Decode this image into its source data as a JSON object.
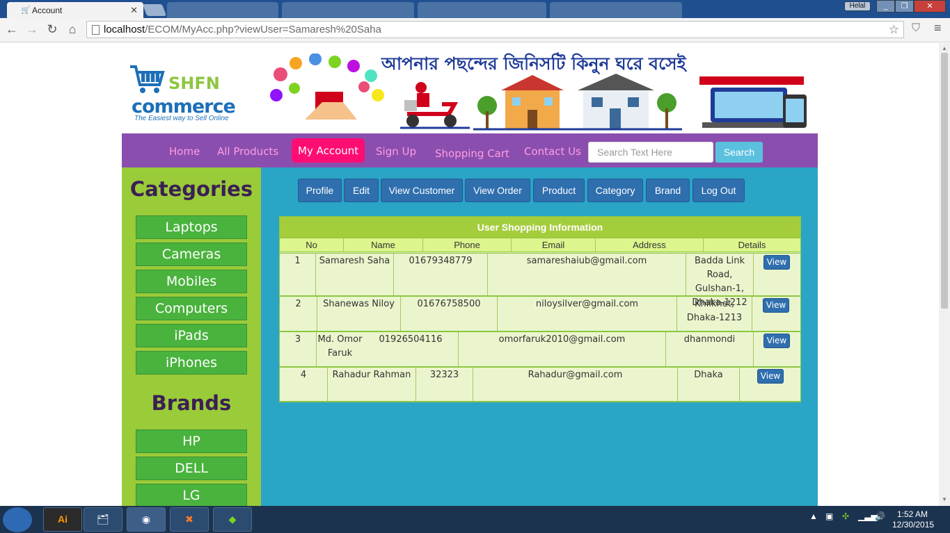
{
  "browser": {
    "active_tab_title": "Account",
    "other_tabs": [
      "",
      "",
      "",
      ""
    ],
    "url_host": "localhost",
    "url_path": "/ECOM/MyAcc.php?viewUser=Samaresh%20Saha",
    "window_user": "Helal"
  },
  "banner": {
    "logo_main": "SHFN",
    "logo_sub": "commerce",
    "logo_tagline": "The Easiest way to Sell Online",
    "tagline": "আপনার পছন্দের জিনিসটি কিনুন ঘরে বসেই"
  },
  "nav": {
    "items": [
      "Home",
      "All Products",
      "My Account",
      "Sign Up",
      "Shopping Cart",
      "Contact Us"
    ],
    "active": "My Account",
    "search_placeholder": "Search Text Here",
    "search_button": "Search"
  },
  "sidebar": {
    "categories_heading": "Categories",
    "categories": [
      "Laptops",
      "Cameras",
      "Mobiles",
      "Computers",
      "iPads",
      "iPhones"
    ],
    "brands_heading": "Brands",
    "brands": [
      "HP",
      "DELL",
      "LG"
    ]
  },
  "admin_menu": [
    "Profile",
    "Edit",
    "View Customer",
    "View Order",
    "Product",
    "Category",
    "Brand",
    "Log Out"
  ],
  "table": {
    "title": "User Shopping Information",
    "headers": [
      "No",
      "Name",
      "Phone",
      "Email",
      "Address",
      "Details"
    ],
    "rows": [
      {
        "no": "1",
        "name": "Samaresh Saha",
        "phone": "01679348779",
        "email": "samareshaiub@gmail.com",
        "address": "Badda Link Road, Gulshan-1, Dhaka-1212",
        "action": "View"
      },
      {
        "no": "2",
        "name": "Shanewas Niloy",
        "phone": "01676758500",
        "email": "niloysilver@gmail.com",
        "address": "Khilkhet, Dhaka-1213",
        "action": "View"
      },
      {
        "no": "3",
        "name": "Md. Omor Faruk",
        "phone": "01926504116",
        "email": "omorfaruk2010@gmail.com",
        "address": "dhanmondi",
        "action": "View"
      },
      {
        "no": "4",
        "name": "Rahadur Rahman",
        "phone": "32323",
        "email": "Rahadur@gmail.com",
        "address": "Dhaka",
        "action": "View"
      }
    ]
  },
  "taskbar": {
    "time": "1:52 AM",
    "date": "12/30/2015",
    "apps": [
      "Ai",
      "explorer",
      "chrome",
      "xampp",
      "app"
    ]
  },
  "colors": {
    "nav_bg": "#8a4fae",
    "nav_active": "#ff0d73",
    "sidebar_bg": "#9acb38",
    "main_bg": "#2aa5c5",
    "button_blue": "#2f6fae"
  }
}
